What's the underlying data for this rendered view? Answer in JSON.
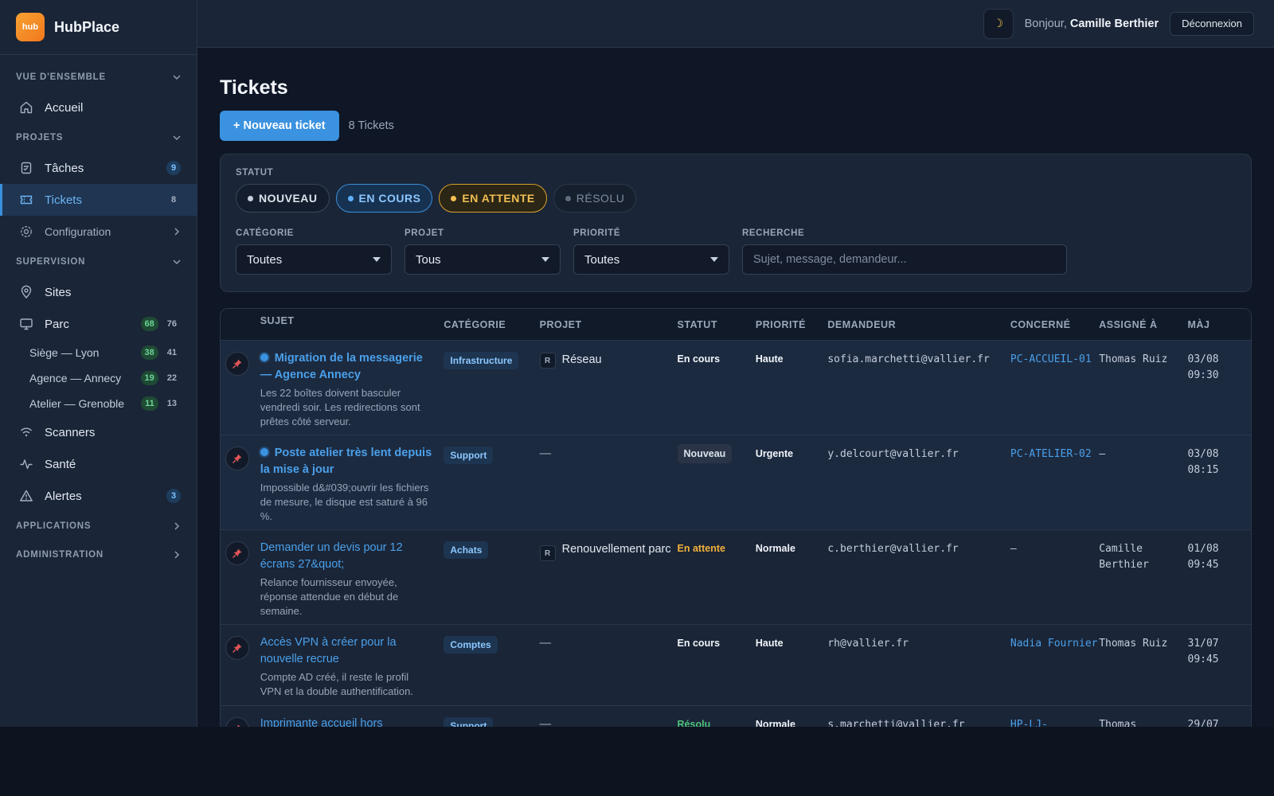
{
  "brand": {
    "logo_text": "hub",
    "name": "HubPlace"
  },
  "sidebar": {
    "sections": {
      "overview": "VUE D'ENSEMBLE",
      "projects": "PROJETS",
      "supervision": "SUPERVISION",
      "applications": "APPLICATIONS",
      "administration": "ADMINISTRATION"
    },
    "home": "Accueil",
    "tasks": {
      "label": "Tâches",
      "count": "9"
    },
    "tickets": {
      "label": "Tickets",
      "count": "8"
    },
    "configuration": "Configuration",
    "sites": "Sites",
    "parc": {
      "label": "Parc",
      "ok": "68",
      "total": "76"
    },
    "sub_sites": [
      {
        "label": "Siège — Lyon",
        "ok": "38",
        "total": "41"
      },
      {
        "label": "Agence — Annecy",
        "ok": "19",
        "total": "22"
      },
      {
        "label": "Atelier — Grenoble",
        "ok": "11",
        "total": "13"
      }
    ],
    "scanners": "Scanners",
    "health": "Santé",
    "alerts": {
      "label": "Alertes",
      "count": "3"
    }
  },
  "topbar": {
    "theme_icon": "moon-icon",
    "greeting": "Bonjour,",
    "user": "Camille Berthier",
    "logout": "Déconnexion"
  },
  "page": {
    "title": "Tickets",
    "new_button": "+ Nouveau ticket",
    "count": "8 Tickets"
  },
  "filters": {
    "status_label": "STATUT",
    "status_pills": [
      "NOUVEAU",
      "EN COURS",
      "EN ATTENTE",
      "RÉSOLU"
    ],
    "category_label": "CATÉGORIE",
    "category_value": "Toutes",
    "project_label": "PROJET",
    "project_value": "Tous",
    "priority_label": "PRIORITÉ",
    "priority_value": "Toutes",
    "search_label": "RECHERCHE",
    "search_placeholder": "Sujet, message, demandeur..."
  },
  "table": {
    "headers": [
      "SUJET",
      "CATÉGORIE",
      "PROJET",
      "STATUT",
      "PRIORITÉ",
      "DEMANDEUR",
      "CONCERNÉ",
      "ASSIGNÉ À",
      "MÀJ"
    ],
    "rows": [
      {
        "subject": "Migration de la messagerie — Agence Annecy",
        "desc": "Les 22 boîtes doivent basculer vendredi soir. Les redirections sont prêtes côté serveur.",
        "category": "Infrastructure",
        "project_badge": "R",
        "project": "Réseau",
        "status": "En cours",
        "priority": "Haute",
        "requester": "sofia.marchetti@vallier.fr",
        "concerned": "PC-ACCUEIL-01",
        "assignee": "Thomas Ruiz",
        "updated_date": "03/08",
        "updated_time": "09:30"
      },
      {
        "subject": "Poste atelier très lent depuis la mise à jour",
        "desc": "Impossible d&#039;ouvrir les fichiers de mesure, le disque est saturé à 96 %.",
        "category": "Support",
        "project_badge": "",
        "project": "—",
        "status": "Nouveau",
        "priority": "Urgente",
        "requester": "y.delcourt@vallier.fr",
        "concerned": "PC-ATELIER-02",
        "assignee": "—",
        "updated_date": "03/08",
        "updated_time": "08:15"
      },
      {
        "subject": "Demander un devis pour 12 écrans 27&quot;",
        "desc": "Relance fournisseur envoyée, réponse attendue en début de semaine.",
        "category": "Achats",
        "project_badge": "R",
        "project": "Renouvellement parc",
        "status": "En attente",
        "priority": "Normale",
        "requester": "c.berthier@vallier.fr",
        "concerned": "—",
        "assignee": "Camille Berthier",
        "updated_date": "01/08",
        "updated_time": "09:45"
      },
      {
        "subject": "Accès VPN à créer pour la nouvelle recrue",
        "desc": "Compte AD créé, il reste le profil VPN et la double authentification.",
        "category": "Comptes",
        "project_badge": "",
        "project": "—",
        "status": "En cours",
        "priority": "Haute",
        "requester": "rh@vallier.fr",
        "concerned": "Nadia Fournier",
        "assignee": "Thomas Ruiz",
        "updated_date": "31/07",
        "updated_time": "09:45"
      },
      {
        "subject": "Imprimante accueil hors",
        "desc": "",
        "category": "Support",
        "project_badge": "",
        "project": "—",
        "status": "Résolu",
        "priority": "Normale",
        "requester": "s.marchetti@vallier.fr",
        "concerned": "HP-LJ-",
        "assignee": "Thomas",
        "updated_date": "29/07",
        "updated_time": ""
      }
    ]
  }
}
